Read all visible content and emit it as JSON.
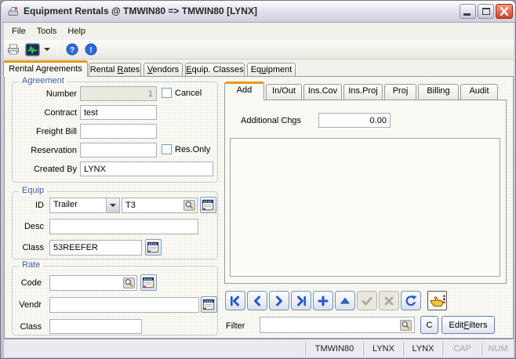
{
  "window": {
    "title": "Equipment Rentals @ TMWIN80 => TMWIN80 [LYNX]"
  },
  "menu": {
    "items": [
      "File",
      "Tools",
      "Help"
    ]
  },
  "main_tabs": [
    {
      "pre": "Rental A",
      "accel": "g",
      "post": "reements"
    },
    {
      "pre": "Rental ",
      "accel": "R",
      "post": "ates"
    },
    {
      "pre": "",
      "accel": "V",
      "post": "endors"
    },
    {
      "pre": "",
      "accel": "E",
      "post": "quip. Classes"
    },
    {
      "pre": "Eq",
      "accel": "u",
      "post": "ipment"
    }
  ],
  "agreement": {
    "legend": "Agreement",
    "number_label": "Number",
    "number_value": "1",
    "cancel_label": "Cancel",
    "contract_label": "Contract",
    "contract_value": "test",
    "freight_label": "Freight Bill",
    "freight_value": "",
    "reservation_label": "Reservation",
    "reservation_value": "",
    "res_only_label": "Res.Only",
    "created_by_label": "Created By",
    "created_by_value": "LYNX"
  },
  "equip": {
    "legend": "Equip",
    "id_label": "ID",
    "type_value": "Trailer",
    "unit_value": "T3",
    "desc_label": "Desc",
    "desc_value": "",
    "class_label": "Class",
    "class_value": "53REEFER"
  },
  "rate": {
    "legend": "Rate",
    "code_label": "Code",
    "code_value": "",
    "vendr_label": "Vendr",
    "vendr_value": "",
    "class_label": "Class",
    "class_value": ""
  },
  "sub_tabs": [
    "Add",
    "In/Out",
    "Ins.Cov",
    "Ins.Proj",
    "Proj",
    "Billing",
    "Audit"
  ],
  "add_tab": {
    "additional_chgs_label": "Additional Chgs",
    "additional_chgs_value": "0.00"
  },
  "nav_buttons": [
    "first",
    "previous",
    "next",
    "last",
    "add",
    "top",
    "accept",
    "cancel",
    "refresh"
  ],
  "filter": {
    "label": "Filter",
    "value": "",
    "clear_button": "C",
    "edit_pre": "Edit ",
    "edit_accel": "F",
    "edit_post": "ilters"
  },
  "statusbar": {
    "panels": [
      "TMWIN80",
      "LYNX",
      "LYNX",
      "CAP",
      "NUM"
    ]
  },
  "colors": {
    "accent_orange": "#E8981C",
    "nav_blue": "#1E5BD6",
    "group_label_blue": "#3A60A8",
    "close_red": "#D6492F"
  }
}
